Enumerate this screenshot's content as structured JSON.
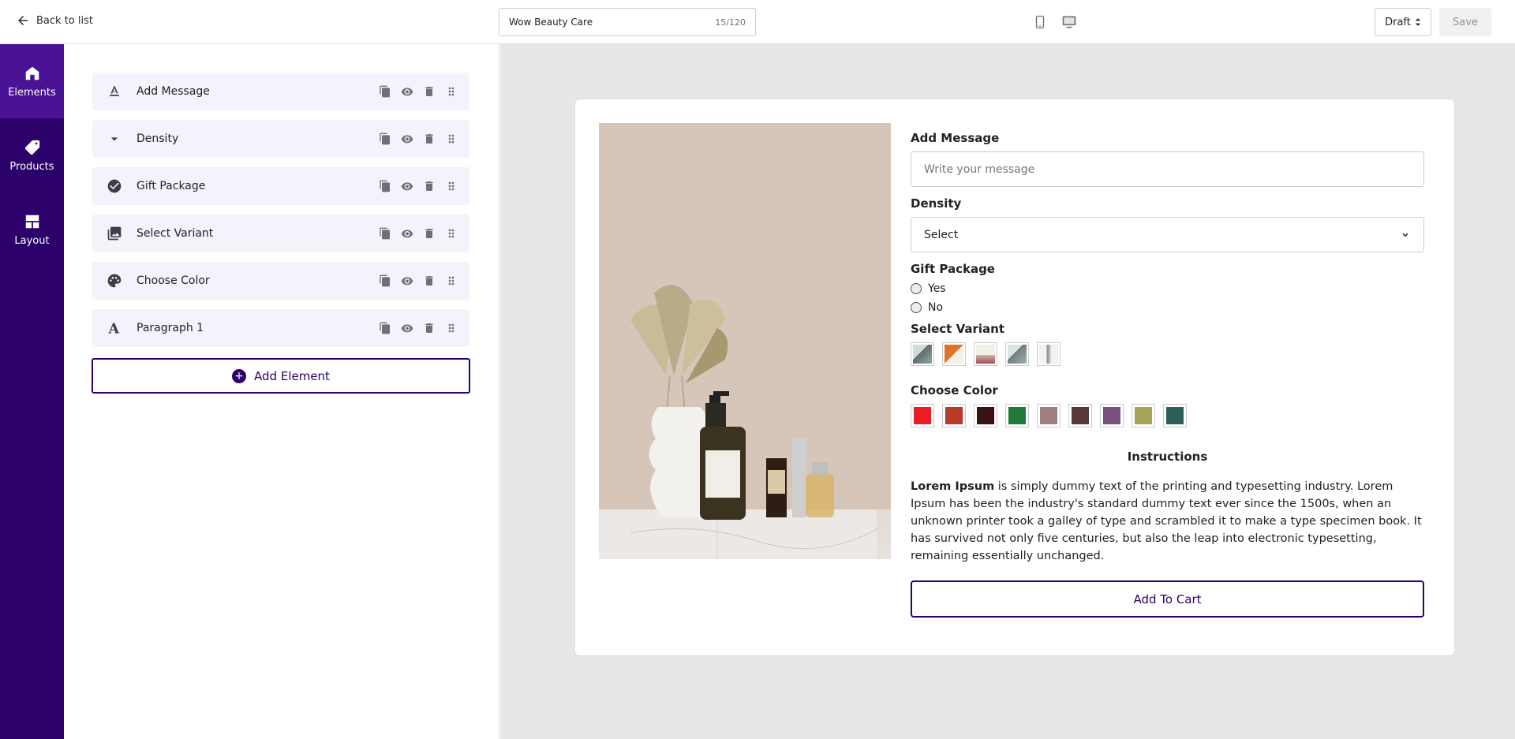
{
  "header": {
    "back_label": "Back to list",
    "title_value": "Wow Beauty Care",
    "title_counter": "15/120",
    "status": "Draft",
    "save_label": "Save"
  },
  "rail": {
    "items": [
      {
        "label": "Elements",
        "icon": "home-icon"
      },
      {
        "label": "Products",
        "icon": "tag-icon"
      },
      {
        "label": "Layout",
        "icon": "layout-icon"
      }
    ]
  },
  "elements": {
    "items": [
      {
        "label": "Add Message",
        "icon": "text-format-icon"
      },
      {
        "label": "Density",
        "icon": "dropdown-arrow-icon"
      },
      {
        "label": "Gift Package",
        "icon": "check-circle-icon"
      },
      {
        "label": "Select Variant",
        "icon": "image-collection-icon"
      },
      {
        "label": "Choose Color",
        "icon": "palette-icon"
      },
      {
        "label": "Paragraph 1",
        "icon": "font-icon"
      }
    ],
    "add_label": "Add Element"
  },
  "preview": {
    "message": {
      "label": "Add Message",
      "placeholder": "Write your message"
    },
    "density": {
      "label": "Density",
      "selected": "Select"
    },
    "gift": {
      "label": "Gift Package",
      "options": [
        "Yes",
        "No"
      ]
    },
    "variant": {
      "label": "Select Variant",
      "thumbs": [
        "#8fa6a4",
        "#e0702c",
        "#c9b6a0",
        "#9fb1b4",
        "#c5c9c6"
      ]
    },
    "color": {
      "label": "Choose Color",
      "swatches": [
        "#ec1c24",
        "#b83a2b",
        "#3a1216",
        "#1f7a37",
        "#a07e7e",
        "#5a3a38",
        "#7a5082",
        "#a5a456",
        "#2e5f55"
      ]
    },
    "instructions": {
      "title": "Instructions",
      "bold": "Lorem Ipsum",
      "text": " is simply dummy text of the printing and typesetting industry. Lorem Ipsum has been the industry's standard dummy text ever since the 1500s, when an unknown printer took a galley of type and scrambled it to make a type specimen book. It has survived not only five centuries, but also the leap into electronic typesetting, remaining essentially unchanged."
    },
    "cart_label": "Add To Cart"
  },
  "colors": {
    "brand": "#2c006a",
    "rail_active": "#4a1294"
  }
}
